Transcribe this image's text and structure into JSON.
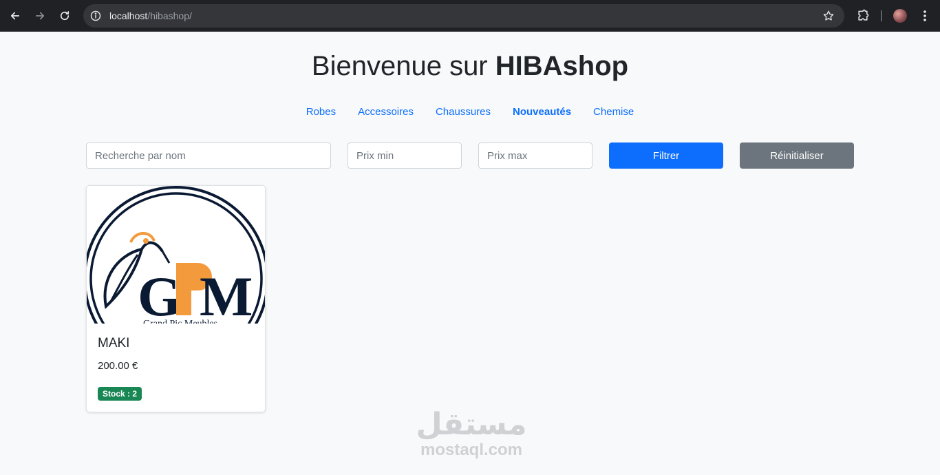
{
  "browser": {
    "url_host": "localhost",
    "url_path": "/hibashop/"
  },
  "header": {
    "title_prefix": "Bienvenue sur ",
    "title_brand": "HIBAshop"
  },
  "categories": [
    {
      "label": "Robes",
      "active": false
    },
    {
      "label": "Accessoires",
      "active": false
    },
    {
      "label": "Chaussures",
      "active": false
    },
    {
      "label": "Nouveautés",
      "active": true
    },
    {
      "label": "Chemise",
      "active": false
    }
  ],
  "filters": {
    "search_placeholder": "Recherche par nom",
    "min_placeholder": "Prix min",
    "max_placeholder": "Prix max",
    "filter_label": "Filtrer",
    "reset_label": "Réinitialiser"
  },
  "products": [
    {
      "name": "MAKI",
      "price": "200.00 €",
      "stock_badge": "Stock : 2",
      "logo_text": "GPM",
      "logo_subtext": "Grand Pic Meubles"
    }
  ],
  "watermark": {
    "arabic": "مستقل",
    "latin": "mostaql.com"
  },
  "colors": {
    "primary": "#0d6efd",
    "secondary": "#6c757d",
    "success": "#198754",
    "navy": "#0b1a33",
    "orange": "#f39a3c"
  }
}
